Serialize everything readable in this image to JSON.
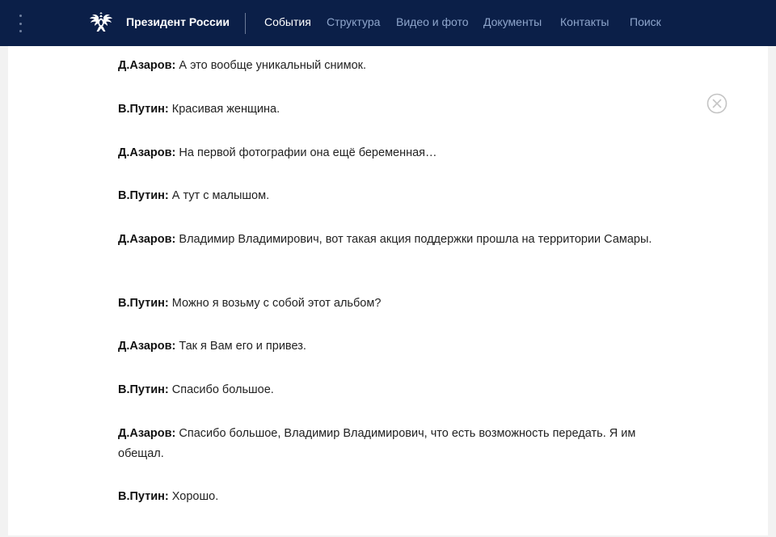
{
  "header": {
    "site_title": "Президент России",
    "nav": [
      {
        "label": "События",
        "active": true
      },
      {
        "label": "Структура"
      },
      {
        "label": "Видео и фото"
      },
      {
        "label": "Документы"
      },
      {
        "label": "Контакты"
      },
      {
        "label": "Поиск"
      }
    ]
  },
  "transcript": [
    {
      "speaker": "Д.Азаров:",
      "text": "А это вообще уникальный снимок."
    },
    {
      "speaker": "В.Путин:",
      "text": "Красивая женщина."
    },
    {
      "speaker": "Д.Азаров:",
      "text": "На первой фотографии она ещё беременная…"
    },
    {
      "speaker": "В.Путин:",
      "text": "А тут с малышом."
    },
    {
      "speaker": "Д.Азаров:",
      "text": "Владимир Владимирович, вот такая акция поддержки прошла на территории Самары."
    },
    {
      "speaker": "В.Путин:",
      "text": "Можно я возьму с собой этот альбом?"
    },
    {
      "speaker": "Д.Азаров:",
      "text": "Так я Вам его и привез."
    },
    {
      "speaker": "В.Путин:",
      "text": "Спасибо большое."
    },
    {
      "speaker": "Д.Азаров:",
      "text": "Спасибо большое, Владимир Владимирович, что есть возможность передать. Я им обещал."
    },
    {
      "speaker": "В.Путин:",
      "text": "Хорошо."
    }
  ],
  "colors": {
    "header_bg": "#0b1f48",
    "nav_inactive": "#8fa6cc",
    "nav_active": "#ffffff",
    "text": "#222222"
  }
}
